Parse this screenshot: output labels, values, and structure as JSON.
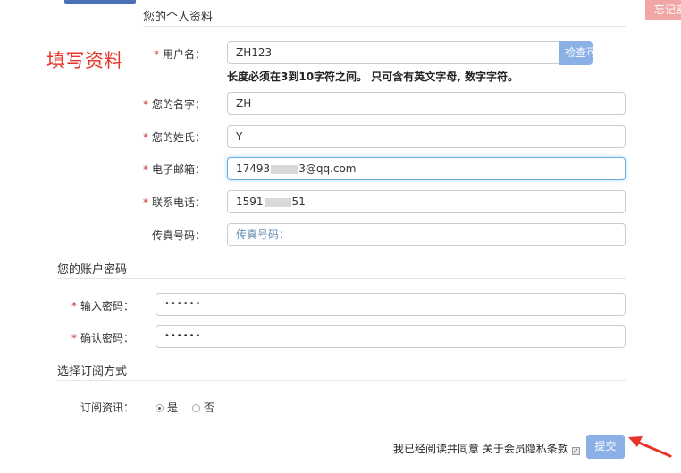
{
  "header": {
    "forgot_label": "忘记密码"
  },
  "annotation": {
    "text": "填写资料"
  },
  "personal": {
    "title": "您的个人资料",
    "username": {
      "label": "用户名：",
      "value": "ZH123",
      "check_label": "检查可用",
      "hint": "长度必须在3到10字符之间。 只可含有英文字母, 数字字符。"
    },
    "first_name": {
      "label": "您的名字：",
      "value": "ZH"
    },
    "last_name": {
      "label": "您的姓氏：",
      "value": "Y"
    },
    "email": {
      "label": "电子邮箱：",
      "value_prefix": "17493",
      "value_suffix": "3@qq.com"
    },
    "phone": {
      "label": "联系电话：",
      "value_prefix": "1591",
      "value_suffix": "51"
    },
    "fax": {
      "label": "传真号码：",
      "placeholder": "传真号码："
    }
  },
  "account": {
    "title": "您的账户密码",
    "password": {
      "label": "输入密码：",
      "value": "••••••"
    },
    "confirm": {
      "label": "确认密码：",
      "value": "••••••"
    }
  },
  "subscription": {
    "title": "选择订阅方式",
    "label": "订阅资讯：",
    "options": [
      "是",
      "否"
    ],
    "selected": "是"
  },
  "footer": {
    "agree_text": "我已经阅读并同意 关于会员隐私条款",
    "submit_label": "提交"
  },
  "colors": {
    "accent": "#8ab0e6",
    "required": "#c9302c",
    "annotation": "#e8352a"
  }
}
